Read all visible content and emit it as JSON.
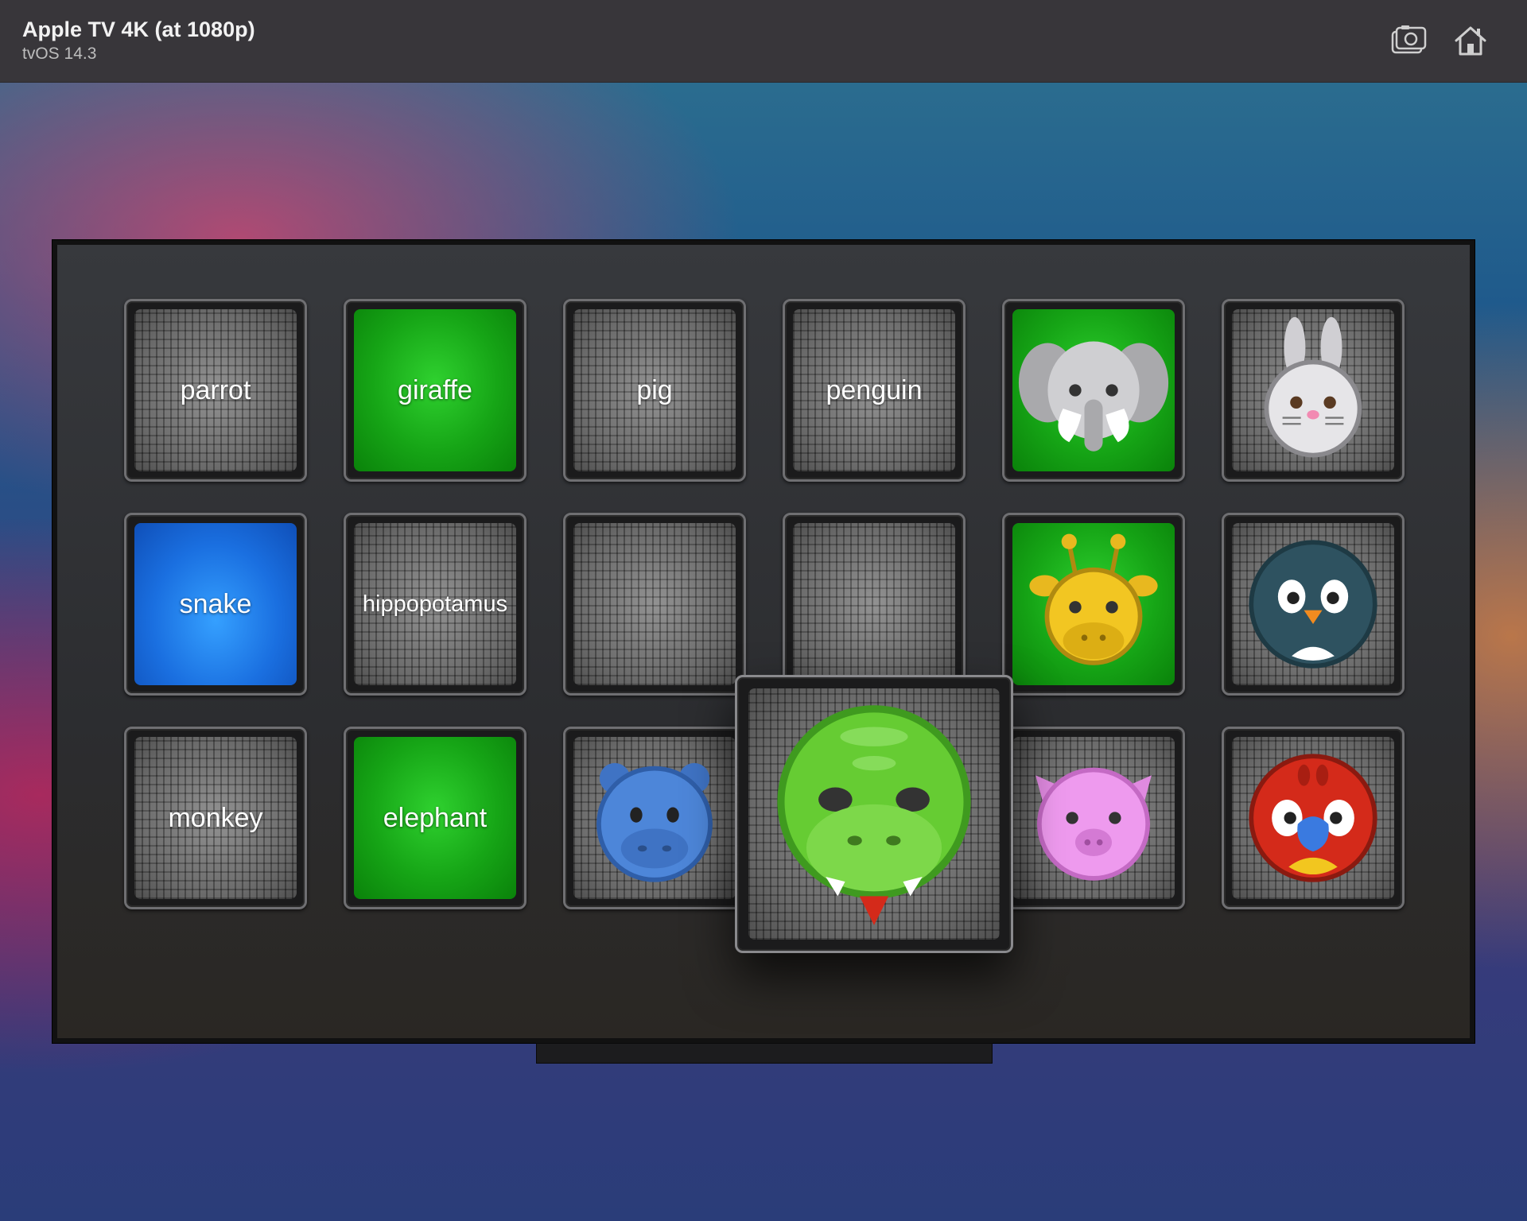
{
  "window": {
    "title": "Apple TV 4K (at 1080p)",
    "subtitle": "tvOS 14.3",
    "screenshot_icon": "camera-icon",
    "home_icon": "home-icon"
  },
  "board": {
    "tiles": [
      {
        "label": "parrot",
        "style": "gray"
      },
      {
        "label": "giraffe",
        "style": "green"
      },
      {
        "label": "pig",
        "style": "gray"
      },
      {
        "label": "penguin",
        "style": "gray"
      },
      {
        "animal": "elephant-icon",
        "style": "green"
      },
      {
        "animal": "rabbit-icon",
        "style": "gray"
      },
      {
        "label": "snake",
        "style": "blue"
      },
      {
        "label": "hippopotamus",
        "style": "gray"
      },
      {
        "label": "",
        "style": "gray"
      },
      {
        "label": "",
        "style": "gray"
      },
      {
        "animal": "giraffe-icon",
        "style": "green"
      },
      {
        "animal": "penguin-icon",
        "style": "gray"
      },
      {
        "label": "monkey",
        "style": "gray"
      },
      {
        "label": "elephant",
        "style": "green"
      },
      {
        "animal": "hippopotamus-icon",
        "style": "gray"
      },
      {
        "animal": "snake-icon",
        "style": "gray",
        "focused": true
      },
      {
        "animal": "pig-icon",
        "style": "gray"
      },
      {
        "animal": "parrot-icon",
        "style": "gray"
      }
    ]
  },
  "colors": {
    "match_green": "#16a516",
    "selected_blue": "#1a6fe0",
    "titlebar": "#38363a"
  }
}
